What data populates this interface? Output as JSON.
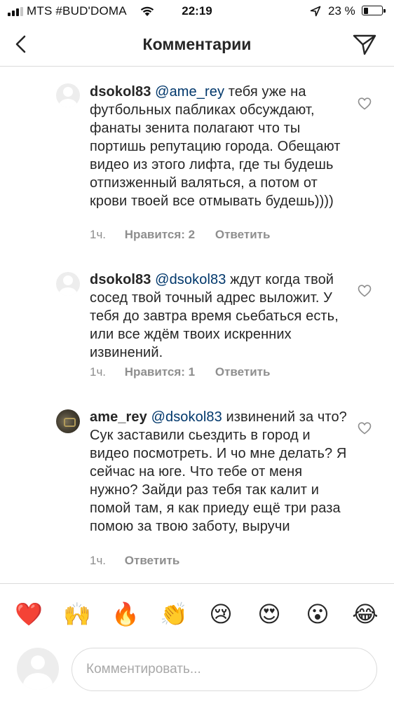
{
  "status_bar": {
    "carrier": "MTS #BUD'DOMA",
    "time": "22:19",
    "battery": "23 %"
  },
  "header": {
    "title": "Комментарии"
  },
  "comments": [
    {
      "username": "dsokol83",
      "mention": "@ame_rey",
      "text": "тебя уже на футбольных пабликах обсуждают, фанаты зенита полагают что ты портишь репутацию города. Обещают видео из этого лифта, где ты будешь отпизженный валяться, а потом от крови твоей все отмывать будешь))))",
      "time": "1ч.",
      "likes": "Нравится: 2",
      "reply": "Ответить"
    },
    {
      "username": "dsokol83",
      "mention": "@dsokol83",
      "text": "ждут когда твой сосед твой точный адрес выложит. У тебя до завтра время сьебаться есть, или все ждём твоих искренних извинений.",
      "time": "1ч.",
      "likes": "Нравится: 1",
      "reply": "Ответить"
    },
    {
      "username": "ame_rey",
      "mention": "@dsokol83",
      "text": "извинений за что? Сук заставили сьездить в город и видео посмотреть. И чо мне делать? Я сейчас на юге. Что тебе от меня нужно? Зайди раз тебя так калит и помой там, я как приеду ещё три раза помою за твою заботу, выручи",
      "time": "1ч.",
      "reply": "Ответить"
    }
  ],
  "emoji_bar": [
    "❤️",
    "🙌",
    "🔥",
    "👏",
    "😢",
    "😍",
    "😮",
    "😂"
  ],
  "input": {
    "placeholder": "Комментировать..."
  }
}
